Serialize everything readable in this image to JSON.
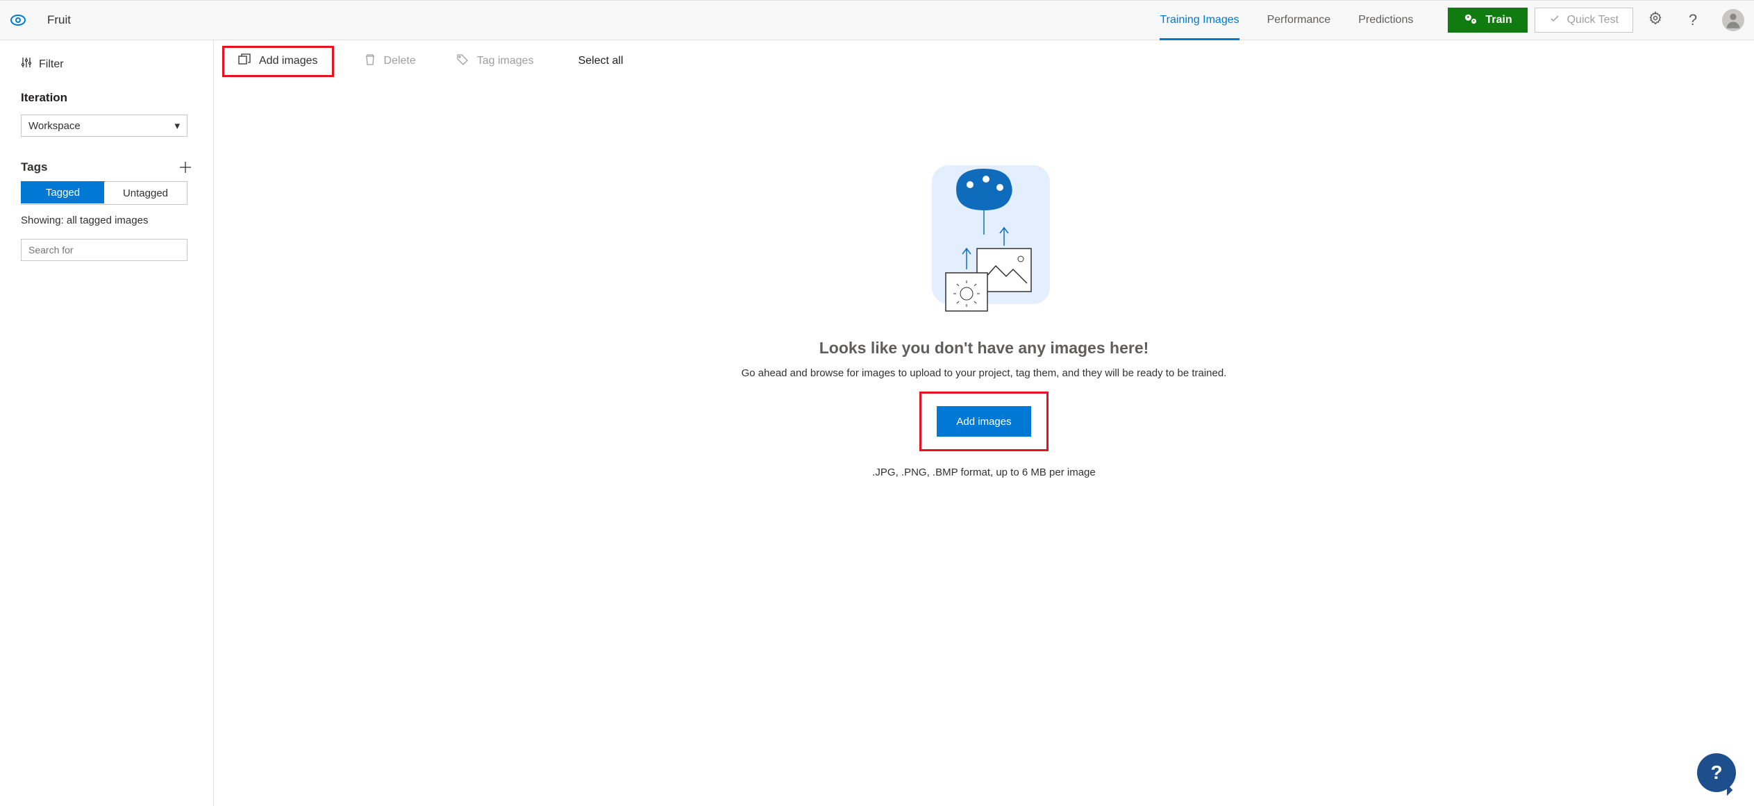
{
  "header": {
    "project_name": "Fruit",
    "tabs": [
      {
        "label": "Training Images",
        "active": true
      },
      {
        "label": "Performance",
        "active": false
      },
      {
        "label": "Predictions",
        "active": false
      }
    ],
    "train_label": "Train",
    "quick_test_label": "Quick Test"
  },
  "sidebar": {
    "filter_label": "Filter",
    "iteration_label": "Iteration",
    "iteration_selected": "Workspace",
    "tags_label": "Tags",
    "toggle": {
      "tagged": "Tagged",
      "untagged": "Untagged",
      "selected": "Tagged"
    },
    "showing_text": "Showing: all tagged images",
    "search_placeholder": "Search for"
  },
  "toolbar": {
    "add_images_label": "Add images",
    "delete_label": "Delete",
    "tag_images_label": "Tag images",
    "select_all_label": "Select all"
  },
  "empty": {
    "title": "Looks like you don't have any images here!",
    "subtitle": "Go ahead and browse for images to upload to your project, tag them, and they will be ready to be trained.",
    "button_label": "Add images",
    "format_text": ".JPG, .PNG, .BMP format, up to 6 MB per image"
  },
  "help_fab": "?"
}
